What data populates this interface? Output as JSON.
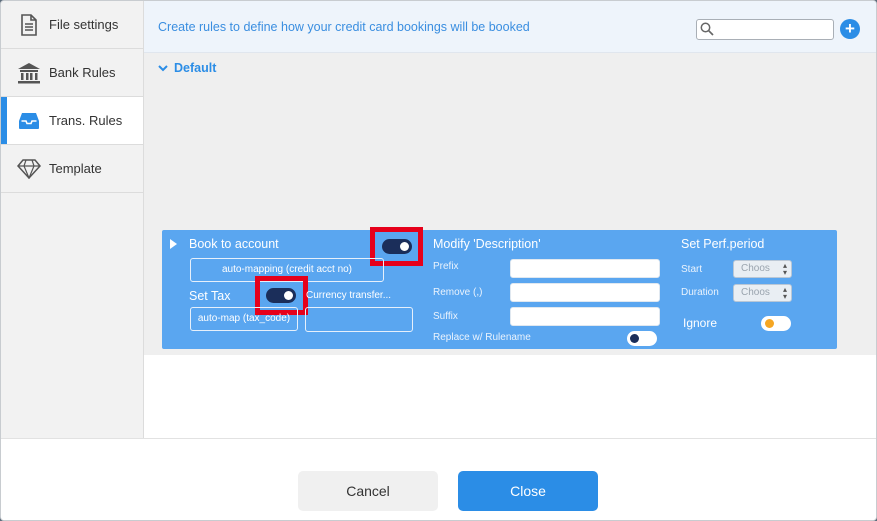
{
  "sidebar": {
    "items": [
      {
        "label": "File settings",
        "icon": "file-icon",
        "active": false
      },
      {
        "label": "Bank Rules",
        "icon": "bank-icon",
        "active": false
      },
      {
        "label": "Trans. Rules",
        "icon": "inbox-icon",
        "active": true
      },
      {
        "label": "Template",
        "icon": "diamond-icon",
        "active": false
      }
    ]
  },
  "header": {
    "description": "Create rules to define how your credit card bookings will be booked",
    "search": {
      "value": "",
      "placeholder": ""
    }
  },
  "group": {
    "label": "Default"
  },
  "rule": {
    "book_to_account": {
      "label": "Book to account",
      "toggle_on": true,
      "mapping_value": "auto-mapping (credit acct no)"
    },
    "set_tax": {
      "label": "Set Tax",
      "toggle_on": true,
      "mapping_value": "auto-map (tax_code)",
      "currency_label": "Currency transfer...",
      "currency_value": ""
    },
    "modify_description": {
      "label": "Modify 'Description'",
      "prefix_label": "Prefix",
      "prefix_value": "",
      "remove_label": "Remove (,)",
      "remove_value": "",
      "suffix_label": "Suffix",
      "suffix_value": "",
      "replace_label": "Replace w/ Rulename",
      "replace_on": false
    },
    "perf_period": {
      "label": "Set Perf.period",
      "start_label": "Start",
      "start_value": "Choos",
      "duration_label": "Duration",
      "duration_value": "Choos"
    },
    "ignore": {
      "label": "Ignore",
      "on": false
    }
  },
  "footer": {
    "cancel_label": "Cancel",
    "close_label": "Close"
  },
  "colors": {
    "accent": "#2b8de6",
    "rule_panel": "#5aa6f0",
    "highlight": "#e6001a",
    "toggle_dark": "#1b2e5a",
    "ignore_knob": "#f5a623"
  }
}
